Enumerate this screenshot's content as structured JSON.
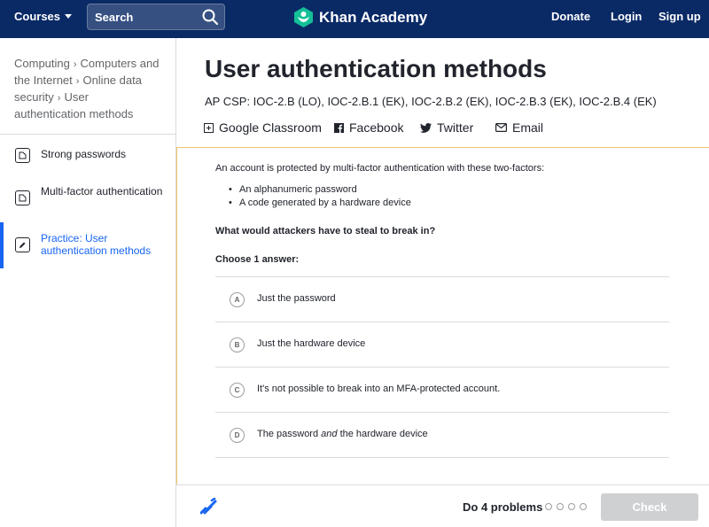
{
  "header": {
    "courses_label": "Courses",
    "search_label": "Search",
    "logo_text": "Khan Academy",
    "donate": "Donate",
    "login": "Login",
    "signup": "Sign up"
  },
  "breadcrumb": {
    "items": [
      "Computing",
      "Computers and the Internet",
      "Online data security",
      "User authentication methods"
    ]
  },
  "sidebar": {
    "items": [
      {
        "label": "Strong passwords",
        "icon": "article-icon"
      },
      {
        "label": "Multi-factor authentication",
        "icon": "article-icon"
      },
      {
        "label": "Practice: User authentication methods",
        "icon": "pencil-icon",
        "active": true
      }
    ]
  },
  "main": {
    "title": "User authentication methods",
    "standards": "AP CSP: IOC-2.B (LO), IOC-2.B.1 (EK), IOC-2.B.2 (EK), IOC-2.B.3 (EK), IOC-2.B.4 (EK)",
    "share": [
      "Google Classroom",
      "Facebook",
      "Twitter",
      "Email"
    ]
  },
  "question": {
    "intro": "An account is protected by multi-factor authentication with these two-factors:",
    "bullets": [
      "An alphanumeric password",
      "A code generated by a hardware device"
    ],
    "prompt": "What would attackers have to steal to break in?",
    "choose": "Choose 1 answer:",
    "choices": [
      {
        "letter": "A",
        "text": "Just the password"
      },
      {
        "letter": "B",
        "text": "Just the hardware device"
      },
      {
        "letter": "C",
        "text": "It's not possible to break into an MFA-protected account."
      },
      {
        "letter": "D",
        "text_before": "The password ",
        "text_em": "and",
        "text_after": " the hardware device"
      }
    ]
  },
  "footer": {
    "progress_label": "Do 4 problems",
    "problems_total": 4,
    "problems_done": 0,
    "check_label": "Check"
  },
  "colors": {
    "nav_bg": "#0a2a66",
    "accent": "#1865f2",
    "panel_border": "#f0c66d",
    "logo_green": "#14bf96"
  }
}
